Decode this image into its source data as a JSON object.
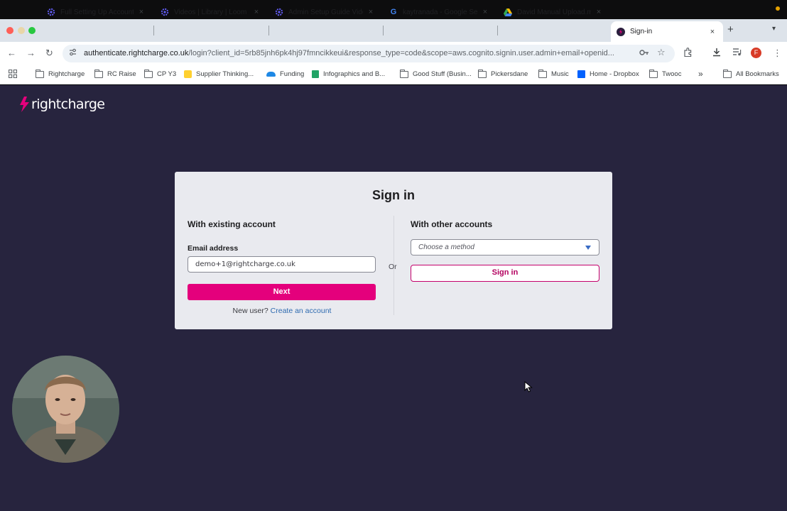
{
  "tabs": [
    {
      "label": "Full Setting Up Account",
      "icon": "gear-icon",
      "close": "×"
    },
    {
      "label": "Videos | Library | Loom",
      "icon": "loom-icon",
      "close": "×"
    },
    {
      "label": "Admin Setup Guide Vide",
      "icon": "loom-icon",
      "close": "×"
    },
    {
      "label": "kaytranada - Google Se",
      "icon": "google-icon",
      "close": "×"
    },
    {
      "label": "David Manual Upload.m",
      "icon": "google-drive-icon",
      "close": "×"
    },
    {
      "label": "Sign-in",
      "icon": "rightcharge-icon",
      "close": "×",
      "active": true
    }
  ],
  "browser": {
    "new_tab": "+",
    "url_host": "authenticate.rightcharge.co.uk",
    "url_path": "/login?client_id=5rb85jnh6pk4hj97fmncikkeui&response_type=code&scope=aws.cognito.signin.user.admin+email+openid...",
    "profile_initial": "F"
  },
  "bookmarks": [
    {
      "label": "Rightcharge",
      "icon": "folder-icon"
    },
    {
      "label": "RC Raise",
      "icon": "folder-icon"
    },
    {
      "label": "CP Y3",
      "icon": "folder-icon"
    },
    {
      "label": "Supplier Thinking...",
      "icon": "miro-icon"
    },
    {
      "label": "Funding",
      "icon": "onedrive-icon"
    },
    {
      "label": "Infographics and B...",
      "icon": "sheets-icon"
    },
    {
      "label": "Good Stuff (Busin...",
      "icon": "folder-icon"
    },
    {
      "label": "Pickersdane",
      "icon": "folder-icon"
    },
    {
      "label": "Music",
      "icon": "folder-icon"
    },
    {
      "label": "Home - Dropbox",
      "icon": "dropbox-icon"
    },
    {
      "label": "Twooc",
      "icon": "folder-icon"
    }
  ],
  "bookmarks_overflow": "»",
  "all_bookmarks": "All Bookmarks",
  "page": {
    "logo_text": "rightcharge",
    "title": "Sign in",
    "existing_heading": "With existing account",
    "email_label": "Email address",
    "email_value": "demo+1@rightcharge.co.uk",
    "next_label": "Next",
    "new_user_text": "New user?",
    "create_account_link": "Create an account",
    "or_text": "Or",
    "other_heading": "With other accounts",
    "method_placeholder": "Choose a method",
    "signin_label": "Sign in"
  },
  "colors": {
    "page_bg": "#27243e",
    "brand_pink": "#e4007c",
    "link_blue": "#2f6bb0"
  }
}
